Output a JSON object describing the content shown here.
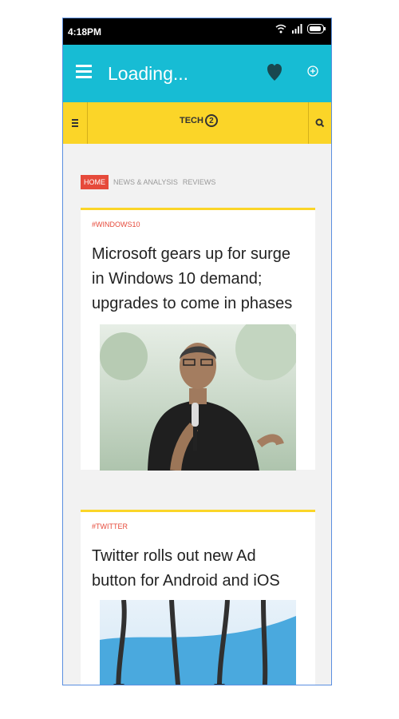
{
  "status_bar": {
    "time": "4:18PM"
  },
  "app_bar": {
    "title": "Loading..."
  },
  "site_bar": {
    "logo_text": "TECH",
    "logo_number": "2"
  },
  "tabs": [
    {
      "label": "HOME",
      "active": true
    },
    {
      "label": "NEWS & ANALYSIS",
      "active": false
    },
    {
      "label": "REVIEWS",
      "active": false
    }
  ],
  "articles": [
    {
      "tag": "#WINDOWS10",
      "headline": "Microsoft gears up for surge in Windows 10 demand; upgrades to come in phases"
    },
    {
      "tag": "#TWITTER",
      "headline": "Twitter rolls out new Ad button for Android and iOS"
    }
  ],
  "colors": {
    "app_bar": "#17bcd4",
    "site_bar": "#fbd528",
    "tag": "#e64a3b",
    "heart": "#19484f"
  },
  "icons": [
    "hamburger-menu-icon",
    "heart-icon",
    "add-circle-icon",
    "search-icon",
    "wifi-icon",
    "signal-icon",
    "battery-icon"
  ]
}
